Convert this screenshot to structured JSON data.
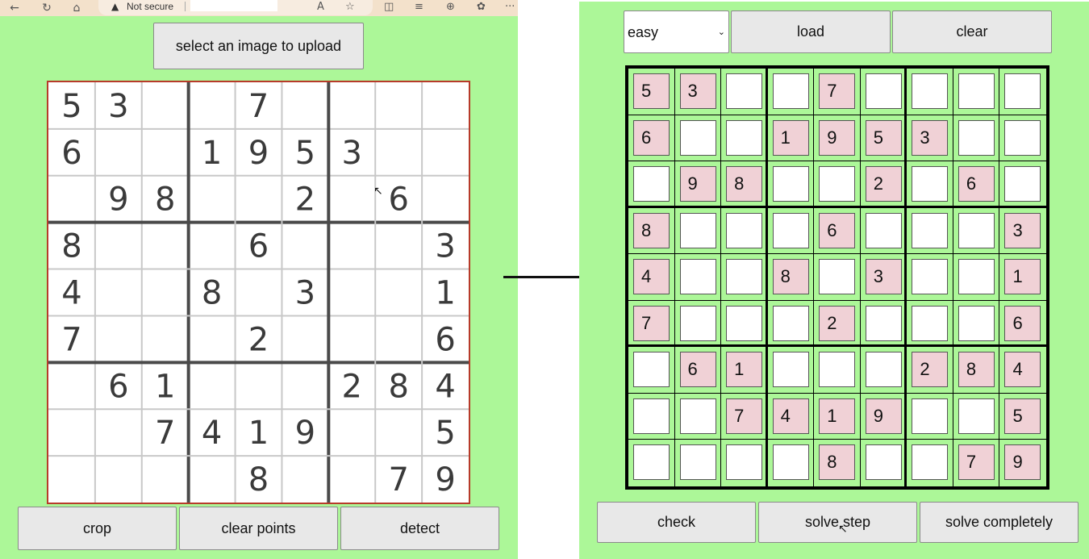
{
  "browser": {
    "back_glyph": "←",
    "refresh_glyph": "↻",
    "home_glyph": "⌂",
    "warning_glyph": "▲",
    "security_label": "Not secure",
    "read_aloud_glyph": "A",
    "favorite_glyph": "☆",
    "split_glyph": "◫",
    "favorites_glyph": "≡",
    "collections_glyph": "⊕",
    "extensions_glyph": "✿",
    "more_glyph": "···"
  },
  "upload": {
    "select_label": "select an image to upload",
    "crop_label": "crop",
    "clear_points_label": "clear points",
    "detect_label": "detect",
    "photo_grid": [
      [
        "5",
        "3",
        "",
        "",
        "7",
        "",
        "",
        "",
        ""
      ],
      [
        "6",
        "",
        "",
        "1",
        "9",
        "5",
        "3",
        "",
        ""
      ],
      [
        "",
        "9",
        "8",
        "",
        "",
        "2",
        "",
        "6",
        ""
      ],
      [
        "8",
        "",
        "",
        "",
        "6",
        "",
        "",
        "",
        "3"
      ],
      [
        "4",
        "",
        "",
        "8",
        "",
        "3",
        "",
        "",
        "1"
      ],
      [
        "7",
        "",
        "",
        "",
        "2",
        "",
        "",
        "",
        "6"
      ],
      [
        "",
        "6",
        "1",
        "",
        "",
        "",
        "2",
        "8",
        "4"
      ],
      [
        "",
        "",
        "7",
        "4",
        "1",
        "9",
        "",
        "",
        "5"
      ],
      [
        "",
        "",
        "",
        "",
        "8",
        "",
        "",
        "7",
        "9"
      ]
    ]
  },
  "solver": {
    "difficulty": "easy",
    "chevron_glyph": "⌄",
    "load_label": "load",
    "clear_label": "clear",
    "check_label": "check",
    "solve_step_label": "solve step",
    "solve_completely_label": "solve completely",
    "given_color": "#f0d1d6",
    "empty_color": "#ffffff",
    "grid": [
      [
        "5",
        "3",
        "",
        "",
        "7",
        "",
        "",
        "",
        ""
      ],
      [
        "6",
        "",
        "",
        "1",
        "9",
        "5",
        "3",
        "",
        ""
      ],
      [
        "",
        "9",
        "8",
        "",
        "",
        "2",
        "",
        "6",
        ""
      ],
      [
        "8",
        "",
        "",
        "",
        "6",
        "",
        "",
        "",
        "3"
      ],
      [
        "4",
        "",
        "",
        "8",
        "",
        "3",
        "",
        "",
        "1"
      ],
      [
        "7",
        "",
        "",
        "",
        "2",
        "",
        "",
        "",
        "6"
      ],
      [
        "",
        "6",
        "1",
        "",
        "",
        "",
        "2",
        "8",
        "4"
      ],
      [
        "",
        "",
        "7",
        "4",
        "1",
        "9",
        "",
        "",
        "5"
      ],
      [
        "",
        "",
        "",
        "",
        "8",
        "",
        "",
        "7",
        "9"
      ]
    ]
  },
  "colors": {
    "app_background": "#acf798",
    "photo_border": "#b73b2a"
  }
}
